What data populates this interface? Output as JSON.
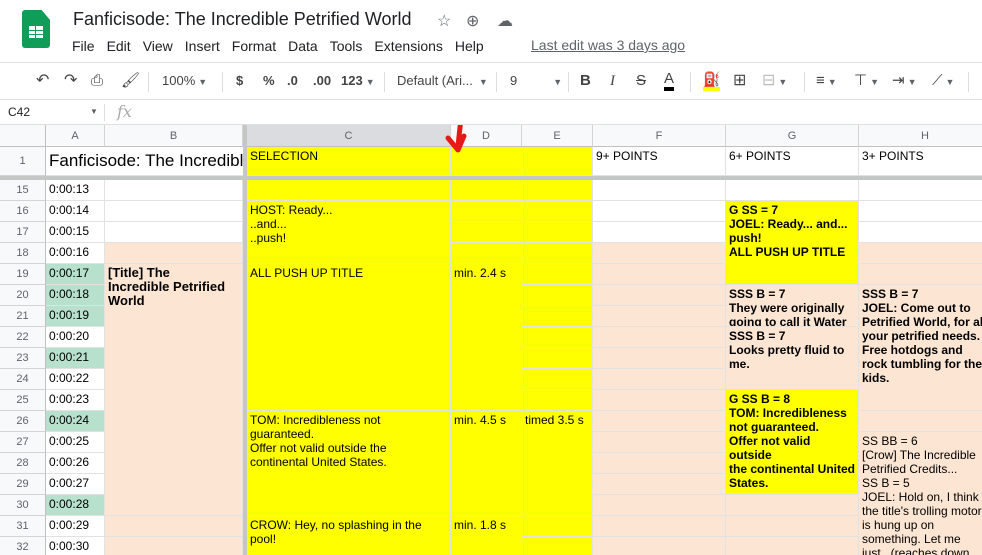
{
  "doc": {
    "title": "Fanficisode: The Incredible Petrified World",
    "last_edit": "Last edit was 3 days ago",
    "star_icon": "☆",
    "move_icon": "⊕",
    "cloud_icon": "☁"
  },
  "menu": [
    "File",
    "Edit",
    "View",
    "Insert",
    "Format",
    "Data",
    "Tools",
    "Extensions",
    "Help"
  ],
  "toolbar": {
    "zoom": "100%",
    "currency": "$",
    "percent": "%",
    "dec_less": ".0",
    "dec_more": ".00",
    "format_more": "123",
    "font": "Default (Ari...",
    "font_size": "9",
    "bold": "B",
    "italic": "I",
    "strike": "S",
    "text_color": "A"
  },
  "formula_bar": {
    "name_box": "C42",
    "fx": "fx"
  },
  "columns": [
    "A",
    "B",
    "C",
    "D",
    "E",
    "F",
    "G",
    "H"
  ],
  "row1": {
    "num": "1",
    "a": "Fanficisode: The Incredible Petrified World",
    "c": "SELECTION",
    "f": "9+ POINTS",
    "g": "6+ POINTS",
    "h": "3+ POINTS"
  },
  "rows": [
    {
      "num": "15",
      "a": "0:00:13"
    },
    {
      "num": "16",
      "a": "0:00:14"
    },
    {
      "num": "17",
      "a": "0:00:15"
    },
    {
      "num": "18",
      "a": "0:00:16"
    },
    {
      "num": "19",
      "a": "0:00:17"
    },
    {
      "num": "20",
      "a": "0:00:18"
    },
    {
      "num": "21",
      "a": "0:00:19"
    },
    {
      "num": "22",
      "a": "0:00:20"
    },
    {
      "num": "23",
      "a": "0:00:21"
    },
    {
      "num": "24",
      "a": "0:00:22"
    },
    {
      "num": "25",
      "a": "0:00:23"
    },
    {
      "num": "26",
      "a": "0:00:24"
    },
    {
      "num": "27",
      "a": "0:00:25"
    },
    {
      "num": "28",
      "a": "0:00:26"
    },
    {
      "num": "29",
      "a": "0:00:27"
    },
    {
      "num": "30",
      "a": "0:00:28"
    },
    {
      "num": "31",
      "a": "0:00:29"
    },
    {
      "num": "32",
      "a": "0:00:30"
    }
  ],
  "cells": {
    "b19": "[Title] The\nIncredible Petrified\nWorld",
    "c16": "HOST: Ready...\n..and...\n..push!",
    "c19": "ALL PUSH UP TITLE",
    "d19": "min. 2.4 s",
    "c26": "TOM: Incredibleness not\nguaranteed.\nOffer not valid outside the\ncontinental United States.",
    "d26": "min. 4.5 s",
    "e26": "timed 3.5 s",
    "c31": "CROW: Hey, no splashing in the\npool!",
    "d31": "min. 1.8 s",
    "g16": "G SS = 7\nJOEL: Ready... and...\npush!\nALL PUSH UP TITLE",
    "g20": "SSS B = 7\nThey were originally\ngoing to call it Water",
    "g22": "SSS B = 7\nLooks pretty fluid to\nme.",
    "g25": "G SS B = 8\nTOM: Incredibleness\nnot guaranteed.\nOffer not valid outside\nthe continental United\nStates.",
    "h20": "SSS B = 7\nJOEL: Come out to\nPetrified World, for all\nyour petrified needs.\nFree hotdogs and\nrock tumbling for the\nkids.",
    "h27": "SS BB = 6\n[Crow] The Incredible\nPetrified Credits...\nSS B = 5\nJOEL: Hold on, I think\nthe title's trolling motor\nis hung up on\nsomething. Let me\njust...(reaches down"
  }
}
